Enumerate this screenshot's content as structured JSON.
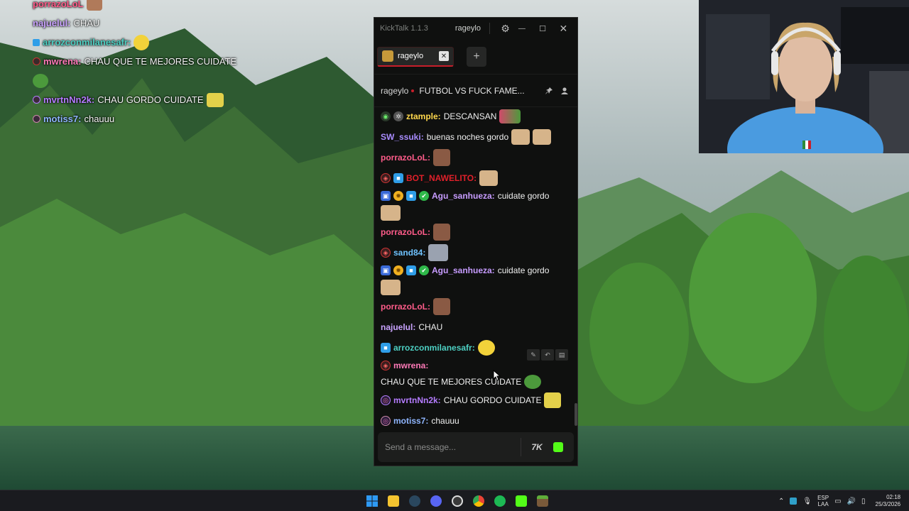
{
  "overlay_chat": [
    {
      "user": "porrazoLoL",
      "text": "",
      "color": "#ff5c8a",
      "emote": true
    },
    {
      "user": "najuelul:",
      "text": "CHAU",
      "color": "#c9a3ff",
      "emote": false
    },
    {
      "user": "arrozconmilanesafr:",
      "text": "",
      "color": "#4dd0c3",
      "emote": true
    },
    {
      "user": "mwrena:",
      "text": "CHAU QUE TE MEJORES CUIDATE",
      "color": "#ff7ab8",
      "emote": false
    },
    {
      "user": "",
      "text": "",
      "color": "#ffffff",
      "emote": true
    },
    {
      "user": "mvrtnNn2k:",
      "text": "CHAU GORDO CUIDATE",
      "color": "#b57cff",
      "emote": true
    },
    {
      "user": "motiss7:",
      "text": "chauuu",
      "color": "#8fb6ff",
      "emote": false
    }
  ],
  "window": {
    "app_title": "KickTalk 1.1.3",
    "current_user": "rageylo",
    "controls": {
      "settings": "⚙",
      "minimize": "—",
      "maximize": "☐",
      "close": "✕"
    }
  },
  "tabs": [
    {
      "label": "rageylo",
      "close": "✕"
    }
  ],
  "add_tab": "+",
  "channel_header": {
    "streamer": "rageylo",
    "stream_title": "FUTBOL VS FUCK FAME...",
    "icons": [
      "pin-icon",
      "user-icon"
    ]
  },
  "messages": [
    {
      "user": "ztample:",
      "text": "DESCANSAN",
      "color": "#ffd84d",
      "badges": [
        "bot-badge",
        "gear-badge"
      ],
      "emotes": 1
    },
    {
      "user": "SW_ssuki:",
      "text": "buenas noches gordo",
      "color": "#a98cff",
      "badges": [],
      "emotes": 2
    },
    {
      "user": "porrazoLoL:",
      "text": "",
      "color": "#ff5c8a",
      "badges": [],
      "emotes": 1
    },
    {
      "user": "BOT_NAWELITO:",
      "text": "",
      "color": "#e0202a",
      "badges": [
        "sub-badge",
        "cube-badge"
      ],
      "emotes": 1
    },
    {
      "user": "Agu_sanhueza:",
      "text": "cuidate gordo",
      "color": "#c79cff",
      "badges": [
        "gift-badge",
        "sun-badge",
        "cube-badge",
        "verified-badge"
      ],
      "emotes": 1
    },
    {
      "user": "porrazoLoL:",
      "text": "",
      "color": "#ff5c8a",
      "badges": [],
      "emotes": 1
    },
    {
      "user": "sand84:",
      "text": "",
      "color": "#6fc3ff",
      "badges": [
        "sub-badge"
      ],
      "emotes": 1
    },
    {
      "user": "Agu_sanhueza:",
      "text": "cuidate gordo",
      "color": "#c79cff",
      "badges": [
        "gift-badge",
        "sun-badge",
        "cube-badge",
        "verified-badge"
      ],
      "emotes": 1
    },
    {
      "user": "porrazoLoL:",
      "text": "",
      "color": "#ff5c8a",
      "badges": [],
      "emotes": 1
    },
    {
      "user": "najuelul:",
      "text": "CHAU",
      "color": "#c9a3ff",
      "badges": [],
      "emotes": 0
    },
    {
      "user": "arrozconmilanesafr:",
      "text": "",
      "color": "#4dd0c3",
      "badges": [
        "cube-badge"
      ],
      "emotes": 1
    },
    {
      "user": "mwrena:",
      "text": "CHAU QUE TE MEJORES CUIDATE",
      "color": "#ff7ab8",
      "badges": [
        "sub-badge"
      ],
      "emotes": 1
    },
    {
      "user": "mvrtnNn2k:",
      "text": "CHAU GORDO CUIDATE",
      "color": "#b57cff",
      "badges": [
        "sub-badge"
      ],
      "emotes": 1
    },
    {
      "user": "motiss7:",
      "text": "chauuu",
      "color": "#8fb6ff",
      "badges": [
        "sub-badge"
      ],
      "emotes": 0
    }
  ],
  "input": {
    "placeholder": "Send a message..."
  },
  "taskbar": {
    "apps": [
      "windows-start-icon",
      "file-explorer-icon",
      "steam-icon",
      "discord-icon",
      "obs-icon",
      "chrome-icon",
      "spotify-icon",
      "kicktalk-icon",
      "minecraft-icon"
    ],
    "lang_line1": "ESP",
    "lang_line2": "LAA",
    "time": "02:18",
    "date": "25/3/2026"
  }
}
